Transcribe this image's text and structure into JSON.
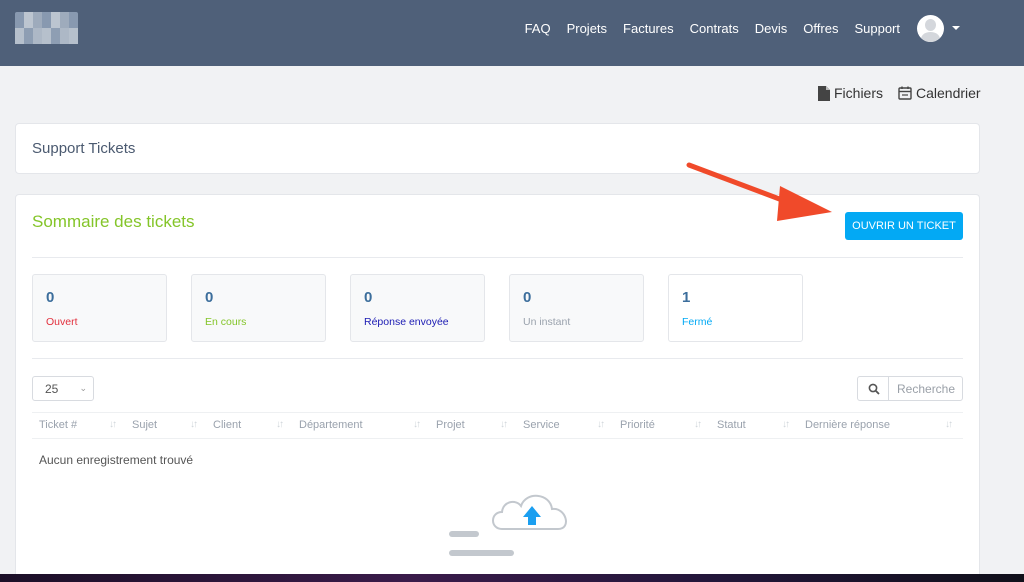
{
  "nav": {
    "items": [
      {
        "label": "FAQ"
      },
      {
        "label": "Projets"
      },
      {
        "label": "Factures"
      },
      {
        "label": "Contrats"
      },
      {
        "label": "Devis"
      },
      {
        "label": "Offres"
      },
      {
        "label": "Support"
      }
    ]
  },
  "top_links": {
    "files": "Fichiers",
    "calendar": "Calendrier"
  },
  "header_panel": {
    "title": "Support Tickets"
  },
  "summary": {
    "title": "Sommaire des tickets",
    "open_button": "OUVRIR UN TICKET",
    "stats": [
      {
        "count": "0",
        "label": "Ouvert",
        "color": "#e2303d"
      },
      {
        "count": "0",
        "label": "En cours",
        "color": "#84c529"
      },
      {
        "count": "0",
        "label": "Réponse envoyée",
        "color": "#1b1bb3"
      },
      {
        "count": "0",
        "label": "Un instant",
        "color": "#9aa2ad"
      },
      {
        "count": "1",
        "label": "Fermé",
        "color": "#03a9f4"
      }
    ]
  },
  "table": {
    "page_length": "25",
    "search_placeholder": "Recherche",
    "columns": [
      "Ticket #",
      "Sujet",
      "Client",
      "Département",
      "Projet",
      "Service",
      "Priorité",
      "Statut",
      "Dernière réponse"
    ],
    "empty_message": "Aucun enregistrement trouvé"
  },
  "colors": {
    "navbar": "#4f6079",
    "accent_blue": "#03a9f4",
    "summary_green": "#84c529",
    "annotation_arrow": "#f04a2a"
  }
}
